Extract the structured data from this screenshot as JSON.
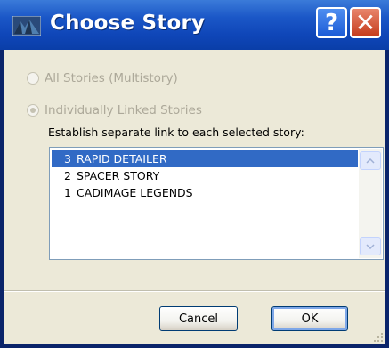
{
  "window": {
    "title": "Choose Story",
    "help_label": "?",
    "close_label": "✕"
  },
  "options": {
    "all_stories": "All Stories (Multistory)",
    "individually_linked": "Individually Linked Stories",
    "selected": "individually_linked",
    "enabled": false
  },
  "instruction": "Establish separate link to each selected story:",
  "stories": [
    {
      "num": "3",
      "name": "RAPID DETAILER",
      "selected": true
    },
    {
      "num": "2",
      "name": "SPACER STORY",
      "selected": false
    },
    {
      "num": "1",
      "name": "CADIMAGE LEGENDS",
      "selected": false
    }
  ],
  "buttons": {
    "cancel": "Cancel",
    "ok": "OK"
  },
  "colors": {
    "titlebar": "#0a3ea8",
    "selection": "#316ac5",
    "face": "#ece9d8"
  }
}
